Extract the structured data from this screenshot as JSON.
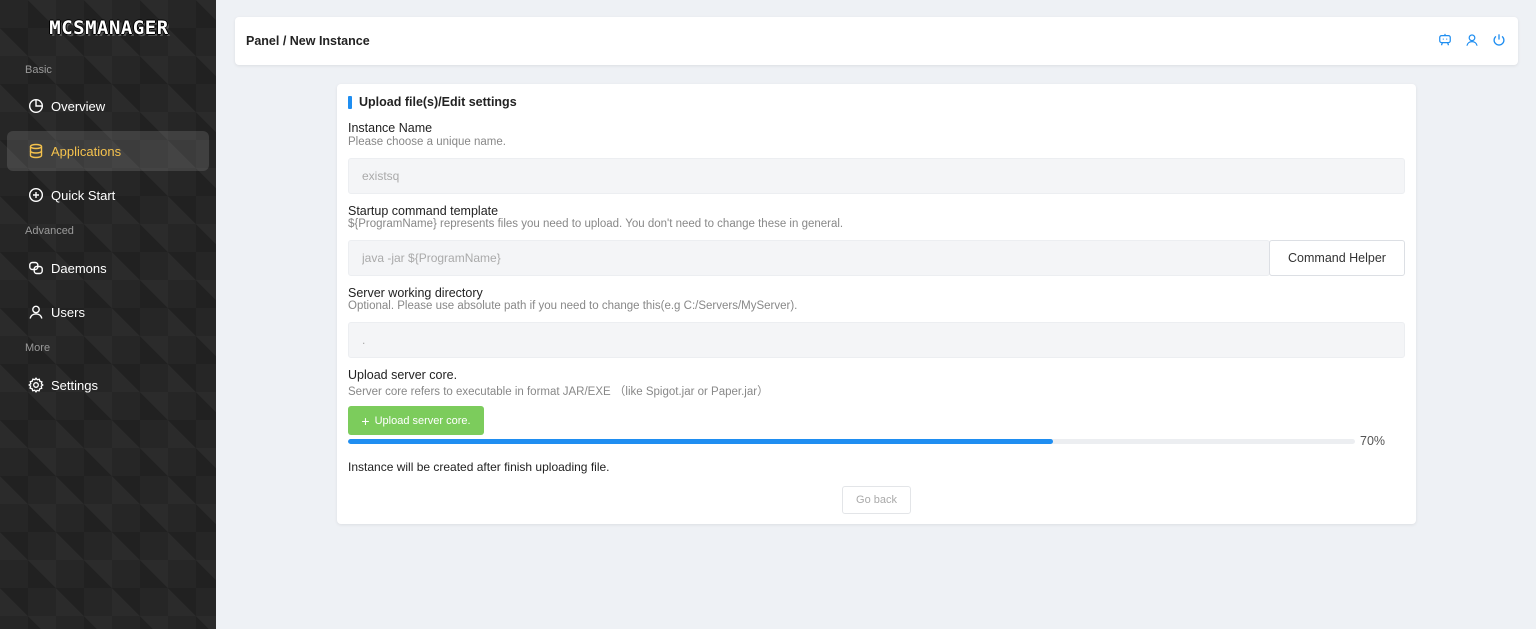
{
  "app": {
    "logo_text": "MCSMANAGER"
  },
  "sidebar": {
    "sections": [
      {
        "label": "Basic"
      },
      {
        "label": "Advanced"
      },
      {
        "label": "More"
      }
    ],
    "items": [
      {
        "label": "Overview",
        "icon": "pie-chart-icon"
      },
      {
        "label": "Applications",
        "icon": "database-icon",
        "active": true
      },
      {
        "label": "Quick Start",
        "icon": "plus-circle-icon"
      },
      {
        "label": "Daemons",
        "icon": "block-icon"
      },
      {
        "label": "Users",
        "icon": "user-icon"
      },
      {
        "label": "Settings",
        "icon": "gear-icon"
      }
    ]
  },
  "header": {
    "breadcrumb": "Panel / New Instance",
    "icons": [
      "robot-icon",
      "user-icon",
      "power-icon"
    ],
    "accent": "#1f8ef1"
  },
  "form": {
    "title": "Upload file(s)/Edit settings",
    "instance_name": {
      "label": "Instance Name",
      "description": "Please choose a unique name.",
      "placeholder": "existsq"
    },
    "startup_command": {
      "label": "Startup command template",
      "description": "${ProgramName} represents files you need to upload. You don't need to change these in general.",
      "placeholder": "java -jar ${ProgramName}",
      "helper_button": "Command Helper"
    },
    "working_dir": {
      "label": "Server working directory",
      "description": "Optional. Please use absolute path if you need to change this(e.g C:/Servers/MyServer).",
      "placeholder": "."
    },
    "upload": {
      "label": "Upload server core.",
      "description": "Server core refers to executable in format JAR/EXE （like Spigot.jar or Paper.jar）",
      "button": "Upload server core.",
      "button_color": "#7ccc5c",
      "progress_percent": 70,
      "progress_text": "70%"
    },
    "note": "Instance will be created after finish uploading file.",
    "go_back": "Go back"
  }
}
